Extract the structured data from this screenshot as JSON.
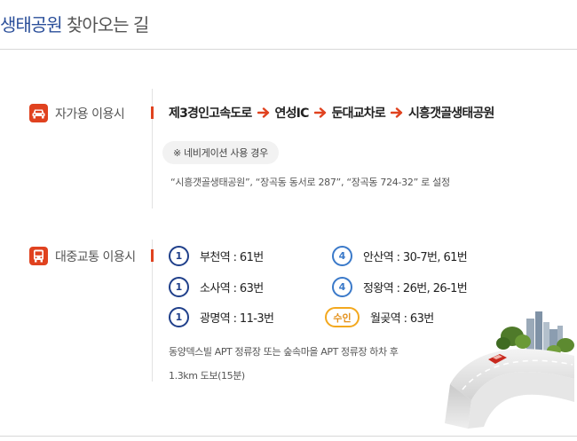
{
  "header": {
    "title_highlight": "생태공원",
    "title_rest": "찾아오는 길"
  },
  "car": {
    "label": "자가용 이용시",
    "icon": "car-icon",
    "route": [
      "제3경인고속도로",
      "연성IC",
      "둔대교차로",
      "시흥갯골생태공원"
    ],
    "nav_badge": "※ 네비게이션 사용 경우",
    "nav_note": "“시흥갯골생태공원”,  “장곡동 동서로 287”,  “장곡동 724-32” 로 설정"
  },
  "transit": {
    "label": "대중교통 이용시",
    "icon": "bus-icon",
    "stations": [
      {
        "line": "1",
        "text": "부천역 : 61번"
      },
      {
        "line": "1",
        "text": "소사역 : 63번"
      },
      {
        "line": "1",
        "text": "광명역 : 11-3번"
      },
      {
        "line": "4",
        "text": "안산역 : 30-7번, 61번"
      },
      {
        "line": "4",
        "text": "정왕역 : 26번, 26-1번"
      },
      {
        "line": "수인",
        "text": "월곶역 : 63번"
      }
    ],
    "bus_note": "동양덱스빌 APT 정류장 또는 숲속마을 APT 정류장 하차 후",
    "walk_note": "1.3km 도보(15분)"
  },
  "colors": {
    "accent": "#e0421f",
    "title_blue": "#2b4f9a",
    "line1": "#1f3f8a",
    "line4": "#3a79c9",
    "suin": "#f3a81e"
  }
}
